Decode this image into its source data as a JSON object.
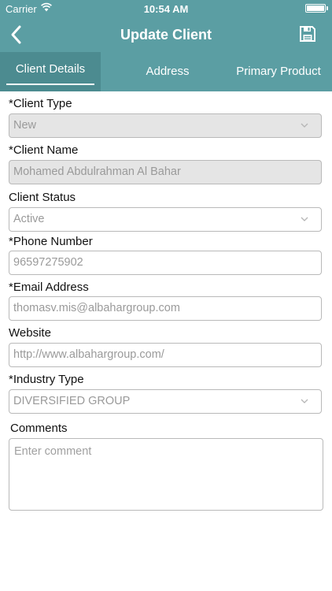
{
  "status_bar": {
    "carrier": "Carrier",
    "time": "10:54 AM"
  },
  "nav": {
    "title": "Update Client",
    "back_icon": "chevron-left-icon",
    "save_icon": "floppy-disk-icon"
  },
  "tabs": [
    "Client Details",
    "Address",
    "Primary Product"
  ],
  "colors": {
    "header": "#5b9ea3",
    "active_tab": "#4c8b90"
  },
  "form": {
    "client_type": {
      "label": "*Client Type",
      "value": "New"
    },
    "client_name": {
      "label": "*Client Name",
      "value": "Mohamed Abdulrahman Al Bahar"
    },
    "client_status": {
      "label": "Client Status",
      "value": "Active"
    },
    "phone": {
      "label": "*Phone Number",
      "value": "96597275902"
    },
    "email": {
      "label": "*Email Address",
      "value": "thomasv.mis@albahargroup.com"
    },
    "website": {
      "label": "Website",
      "value": "http://www.albahargroup.com/"
    },
    "industry": {
      "label": "*Industry Type",
      "value": "DIVERSIFIED GROUP"
    },
    "comments": {
      "label": "Comments",
      "placeholder": "Enter comment"
    }
  }
}
